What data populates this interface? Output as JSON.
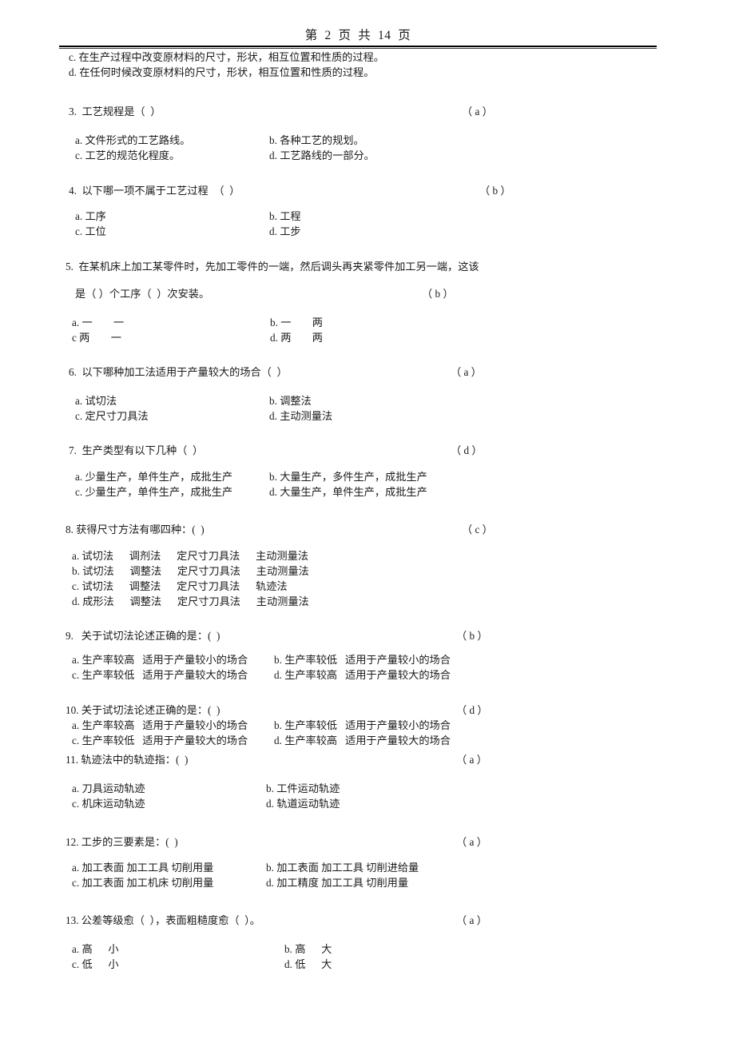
{
  "header": {
    "page_label": "第  2  页  共  14  页"
  },
  "carryover": {
    "option_c": "c. 在生产过程中改变原材料的尺寸，形状，相互位置和性质的过程。",
    "option_d": "d. 在任何时候改变原材料的尺寸，形状，相互位置和性质的过程。"
  },
  "questions": [
    {
      "number": "3.",
      "stem": "3.  工艺规程是（  ）",
      "answer": "（ a ）",
      "rows": [
        {
          "a": "a. 文件形式的工艺路线。",
          "b": "b. 各种工艺的规划。"
        },
        {
          "a": "c. 工艺的规范化程度。",
          "b": "d. 工艺路线的一部分。"
        }
      ]
    },
    {
      "number": "4.",
      "stem": "4.  以下哪一项不属于工艺过程  （  ）",
      "answer": "（ b ）",
      "rows": [
        {
          "a": "a. 工序",
          "b": "b. 工程"
        },
        {
          "a": "c. 工位",
          "b": "d. 工步"
        }
      ]
    },
    {
      "number": "5.",
      "stem": "5.  在某机床上加工某零件时，先加工零件的一端，然后调头再夹紧零件加工另一端，这该",
      "stem2": "是（ ）个工序（  ）次安装。",
      "answer": "（ b ）",
      "rows": [
        {
          "a": "a. 一        一",
          "b": "b. 一        两"
        },
        {
          "a": "c 两        一",
          "b": "d. 两        两"
        }
      ]
    },
    {
      "number": "6.",
      "stem": "6.  以下哪种加工法适用于产量较大的场合（  ）",
      "answer": "（ a ）",
      "rows": [
        {
          "a": "a. 试切法",
          "b": "b. 调整法"
        },
        {
          "a": "c. 定尺寸刀具法",
          "b": "d. 主动测量法"
        }
      ]
    },
    {
      "number": "7.",
      "stem": "7.  生产类型有以下几种（  ）",
      "answer": "（ d ）",
      "rows": [
        {
          "a": "a. 少量生产，单件生产，成批生产",
          "b": "b. 大量生产，多件生产，成批生产"
        },
        {
          "a": "c. 少量生产，单件生产，成批生产",
          "b": "d. 大量生产，单件生产，成批生产"
        }
      ]
    },
    {
      "number": "8.",
      "stem": "8. 获得尺寸方法有哪四种：(  )",
      "answer": "（ c ）",
      "lines": [
        "a. 试切法      调剂法      定尺寸刀具法      主动测量法",
        "b. 试切法      调整法      定尺寸刀具法      主动测量法",
        "c. 试切法      调整法      定尺寸刀具法      轨迹法",
        "d. 成形法      调整法      定尺寸刀具法      主动测量法"
      ]
    },
    {
      "number": "9.",
      "stem": "9.   关于试切法论述正确的是：(  )",
      "answer": "（ b ）",
      "rows": [
        {
          "a": "a. 生产率较高   适用于产量较小的场合",
          "b": "b. 生产率较低   适用于产量较小的场合"
        },
        {
          "a": "c. 生产率较低   适用于产量较大的场合",
          "b": "d. 生产率较高   适用于产量较大的场合"
        }
      ]
    },
    {
      "number": "10.",
      "stem": "10. 关于试切法论述正确的是：(  )",
      "answer": "（ d ）",
      "rows": [
        {
          "a": "a. 生产率较高   适用于产量较小的场合",
          "b": "b. 生产率较低   适用于产量较小的场合"
        },
        {
          "a": "c. 生产率较低   适用于产量较大的场合",
          "b": "d. 生产率较高   适用于产量较大的场合"
        }
      ]
    },
    {
      "number": "11.",
      "stem": "11. 轨迹法中的轨迹指：(  )",
      "answer": "（ a ）",
      "rows": [
        {
          "a": "a. 刀具运动轨迹",
          "b": "b. 工件运动轨迹"
        },
        {
          "a": "c. 机床运动轨迹",
          "b": "d. 轨道运动轨迹"
        }
      ]
    },
    {
      "number": "12.",
      "stem": "12. 工步的三要素是：(  )",
      "answer": "（ a ）",
      "rows": [
        {
          "a": "a. 加工表面 加工工具 切削用量",
          "b": "b. 加工表面 加工工具 切削进给量"
        },
        {
          "a": "c. 加工表面 加工机床 切削用量",
          "b": "d. 加工精度 加工工具 切削用量"
        }
      ]
    },
    {
      "number": "13.",
      "stem": "13. 公差等级愈（  ），表面粗糙度愈（  ）。",
      "answer": "（ a ）",
      "rows": [
        {
          "a": "a. 高      小",
          "b": "b. 高      大"
        },
        {
          "a": "c. 低      小",
          "b": "d. 低      大"
        }
      ]
    }
  ]
}
